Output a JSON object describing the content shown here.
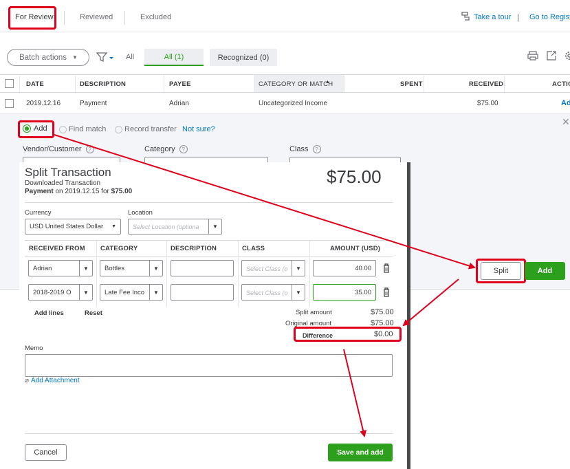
{
  "tabs": {
    "for_review": "For Review",
    "reviewed": "Reviewed",
    "excluded": "Excluded"
  },
  "top_links": {
    "take_tour": "Take a tour",
    "separator": "|",
    "go_to_register": "Go to Registe"
  },
  "toolbar": {
    "batch_actions": "Batch actions",
    "all_filter": "All",
    "tab_all": "All (1)",
    "tab_recognized": "Recognized (0)"
  },
  "table": {
    "headers": {
      "date": "DATE",
      "description": "DESCRIPTION",
      "payee": "PAYEE",
      "category": "CATEGORY OR MATCH",
      "spent": "SPENT",
      "received": "RECEIVED",
      "action": "ACTIO"
    },
    "row": {
      "date": "2019.12.16",
      "description": "Payment",
      "payee": "Adrian",
      "category": "Uncategorized Income",
      "spent": "",
      "received": "$75.00",
      "action": "Ad"
    }
  },
  "detail": {
    "options": {
      "add": "Add",
      "find_match": "Find match",
      "record_transfer": "Record transfer",
      "not_sure": "Not sure?"
    },
    "labels": {
      "vendor_customer": "Vendor/Customer",
      "category": "Category",
      "class": "Class"
    },
    "split_button": "Split",
    "add_button": "Add"
  },
  "split_dialog": {
    "title": "Split Transaction",
    "subtitle": "Downloaded Transaction",
    "payment_prefix": "Payment",
    "payment_on": " on 2019.12.15 for ",
    "payment_amount": "$75.00",
    "amount": "$75.00",
    "currency_label": "Currency",
    "currency_value": "USD United States Dollar",
    "location_label": "Location",
    "location_placeholder": "Select Location (optiona",
    "columns": {
      "received_from": "RECEIVED FROM",
      "category": "CATEGORY",
      "description": "DESCRIPTION",
      "class": "CLASS",
      "amount": "AMOUNT (USD)"
    },
    "lines": [
      {
        "received_from": "Adrian",
        "category": "Bottles",
        "description": "",
        "class_placeholder": "Select Class (o",
        "amount": "40.00"
      },
      {
        "received_from": "2018-2019 O",
        "category": "Late Fee Inco",
        "description": "",
        "class_placeholder": "Select Class (o",
        "amount": "35.00"
      }
    ],
    "add_lines": "Add lines",
    "reset": "Reset",
    "totals": {
      "split_label": "Split amount",
      "split_value": "$75.00",
      "original_label": "Original amount",
      "original_value": "$75.00",
      "difference_label": "Difference",
      "difference_value": "$0.00"
    },
    "memo_label": "Memo",
    "add_attachment": "Add Attachment",
    "cancel": "Cancel",
    "save_and_add": "Save and add"
  },
  "colors": {
    "accent": "#0077c5",
    "green": "#2ca01c",
    "highlight": "#e0001b"
  }
}
